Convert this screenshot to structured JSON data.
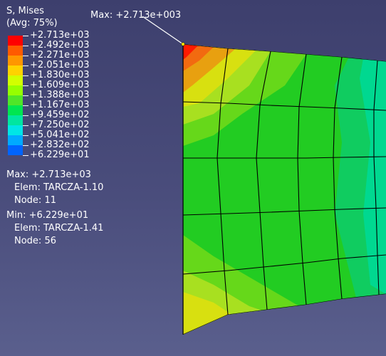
{
  "legend": {
    "title": "S, Mises",
    "subtitle": "(Avg: 75%)",
    "values": [
      "+2.713e+03",
      "+2.492e+03",
      "+2.271e+03",
      "+2.051e+03",
      "+1.830e+03",
      "+1.609e+03",
      "+1.388e+03",
      "+1.167e+03",
      "+9.459e+02",
      "+7.250e+02",
      "+5.041e+02",
      "+2.832e+02",
      "+6.229e+01"
    ],
    "colors": [
      "#ff0000",
      "#ff5a00",
      "#ff9600",
      "#ffd200",
      "#d2ff00",
      "#96ff00",
      "#50e628",
      "#00e650",
      "#00e6a0",
      "#00e6e6",
      "#00aaff",
      "#0064ff",
      "#0000ff"
    ]
  },
  "max_info": {
    "label": "Max: +2.713e+03",
    "elem": "Elem: TARCZA-1.10",
    "node": "Node: 11"
  },
  "min_info": {
    "label": "Min: +6.229e+01",
    "elem": "Elem: TARCZA-1.41",
    "node": "Node: 56"
  },
  "callout": {
    "text": "Max: +2.713e+003"
  },
  "mesh_colors": {
    "red": "#ff1a00",
    "orange": "#f26a10",
    "amber": "#e8a010",
    "yellow": "#d8e010",
    "yellowgreen": "#a8e020",
    "lightgreen": "#66d81a",
    "green": "#22cc22",
    "teal": "#10cc60",
    "cyan": "#00d890"
  }
}
